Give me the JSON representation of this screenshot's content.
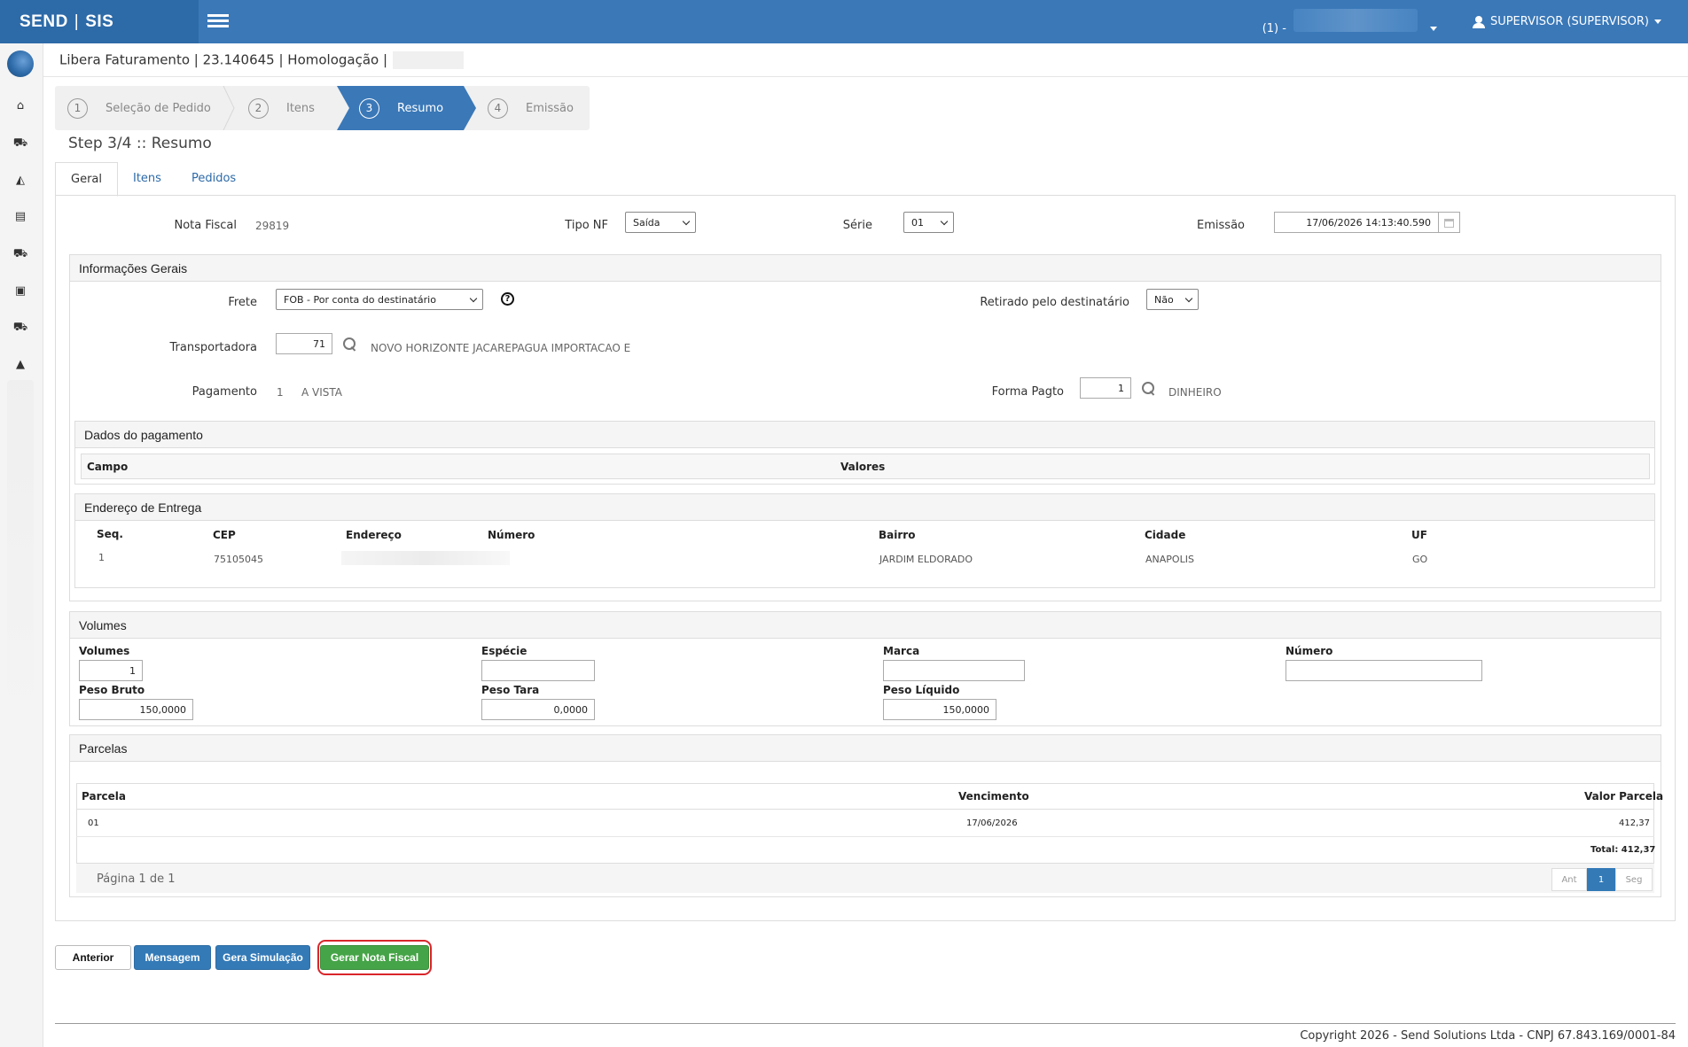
{
  "header": {
    "brand_left": "SEND",
    "brand_right": "SIS",
    "tenant": "(1) -",
    "user": "SUPERVISOR (SUPERVISOR)"
  },
  "breadcrumb": "Libera Faturamento | 23.140645 | Homologação |",
  "wizard": {
    "steps": [
      {
        "num": "1",
        "label": "Seleção de Pedido"
      },
      {
        "num": "2",
        "label": "Itens"
      },
      {
        "num": "3",
        "label": "Resumo"
      },
      {
        "num": "4",
        "label": "Emissão"
      }
    ],
    "title": "Step 3/4 :: Resumo"
  },
  "tabs": [
    "Geral",
    "Itens",
    "Pedidos"
  ],
  "geral": {
    "nota_fiscal_label": "Nota Fiscal",
    "nota_fiscal": "29819",
    "tipo_nf_label": "Tipo NF",
    "tipo_nf": "Saída",
    "serie_label": "Série",
    "serie": "01",
    "emissao_label": "Emissão",
    "emissao": "17/06/2026 14:13:40.590"
  },
  "info": {
    "title": "Informações Gerais",
    "frete_label": "Frete",
    "frete": "FOB - Por conta do destinatário",
    "retirado_label": "Retirado pelo destinatário",
    "retirado": "Não",
    "transp_label": "Transportadora",
    "transp_code": "71",
    "transp_name": "NOVO HORIZONTE JACAREPAGUA IMPORTACAO E",
    "pag_label": "Pagamento",
    "pag_code": "1",
    "pag_name": "A VISTA",
    "forma_label": "Forma Pagto",
    "forma_code": "1",
    "forma_name": "DINHEIRO"
  },
  "dados_pagamento": {
    "title": "Dados do pagamento",
    "col_campo": "Campo",
    "col_valores": "Valores"
  },
  "endereco": {
    "title": "Endereço de Entrega",
    "cols": [
      "Seq.",
      "CEP",
      "Endereço",
      "Número",
      "Bairro",
      "Cidade",
      "UF"
    ],
    "row": {
      "seq": "1",
      "cep": "75105045",
      "bairro": "JARDIM ELDORADO",
      "cidade": "ANAPOLIS",
      "uf": "GO"
    }
  },
  "volumes": {
    "title": "Volumes",
    "volumes_label": "Volumes",
    "volumes": "1",
    "especie_label": "Espécie",
    "especie": "",
    "marca_label": "Marca",
    "marca": "",
    "numero_label": "Número",
    "numero": "",
    "peso_bruto_label": "Peso Bruto",
    "peso_bruto": "150,0000",
    "peso_tara_label": "Peso Tara",
    "peso_tara": "0,0000",
    "peso_liquido_label": "Peso Líquido",
    "peso_liquido": "150,0000"
  },
  "parcelas": {
    "title": "Parcelas",
    "col_parcela": "Parcela",
    "col_vencimento": "Vencimento",
    "col_valor": "Valor Parcela",
    "row": {
      "parcela": "01",
      "vencimento": "17/06/2026",
      "valor": "412,37"
    },
    "total": "Total: 412,37",
    "pagina": "Página 1 de 1",
    "ant": "Ant",
    "page": "1",
    "seg": "Seg"
  },
  "buttons": {
    "anterior": "Anterior",
    "mensagem": "Mensagem",
    "simulacao": "Gera Simulação",
    "gerar": "Gerar Nota Fiscal"
  },
  "footer": "Copyright 2026 - Send Solutions Ltda - CNPJ 67.843.169/0001-84"
}
